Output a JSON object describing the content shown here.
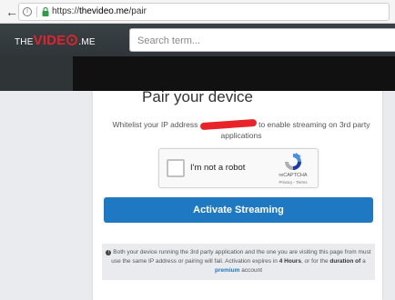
{
  "browser": {
    "url_scheme": "https://",
    "url_host": "thevideo.me",
    "url_path": "/pair"
  },
  "header": {
    "logo_the": "THE",
    "logo_video": "VIDE",
    "logo_me": ".ME",
    "search_placeholder": "Search term..."
  },
  "card": {
    "title": "Pair your device",
    "whitelist_before": "Whitelist your IP address",
    "whitelist_after": "to enable streaming on 3rd party applications"
  },
  "recaptcha": {
    "label": "I'm not a robot",
    "brand": "reCAPTCHA",
    "links": "Privacy - Terms"
  },
  "activate_button": {
    "label": "Activate Streaming"
  },
  "notice": {
    "text_1": "Both your device running the 3rd party application and the one you are visiting this page from must use the same IP address or pairing will fail. Activation expires in",
    "hours": "4 Hours",
    "text_2": ", or for the",
    "duration": "duration of",
    "text_3": "a",
    "premium": "premium",
    "text_4": "account"
  },
  "colors": {
    "accent": "#1e78c2",
    "brand_red": "#e0242c",
    "header_bg": "#2f3539"
  },
  "icons": {
    "back": "back-arrow-icon",
    "info": "info-icon",
    "lock": "lock-icon",
    "notice": "exclamation-circle-icon",
    "captcha": "recaptcha-logo-icon"
  }
}
